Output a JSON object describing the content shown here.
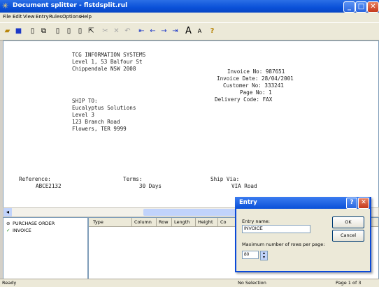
{
  "window": {
    "title": "Document splitter - flstdsplit.rul"
  },
  "menu": [
    "File",
    "Edit",
    "View",
    "Entry",
    "Rules",
    "Options",
    "Help"
  ],
  "toolbar": {
    "icons": [
      "open-icon",
      "save-icon",
      "new-doc-icon",
      "copy-doc-icon",
      "page-icon",
      "page2-icon",
      "page3-icon",
      "pointer-icon",
      "cut-icon",
      "delete-icon",
      "undo-icon",
      "first-icon",
      "prev-icon",
      "next-icon",
      "last-icon",
      "font-larger-icon",
      "font-smaller-icon",
      "help-icon"
    ]
  },
  "document": {
    "company": [
      "TCG INFORMATION SYSTEMS",
      "Level 1, 53 Balfour St",
      "Chippendale NSW 2008"
    ],
    "invoice_info": [
      "Invoice No: 987651",
      "Invoice Date: 28/04/2001",
      "Customer No: 333241",
      "Page No: 1",
      "Delivery Code: FAX"
    ],
    "ship_to": [
      "SHIP TO:",
      "Eucalyptus Solutions",
      "Level 3",
      "123 Branch Road",
      "Flowers, TER 9999"
    ],
    "reference_label": "Reference:",
    "reference_value": "ABCE2132",
    "terms_label": "Terms:",
    "terms_value": "30 Days",
    "ship_via_label": "Ship Via:",
    "ship_via_value": "VIA Road"
  },
  "tree": [
    "PURCHASE ORDER",
    "INVOICE"
  ],
  "grid": {
    "columns": [
      "Type",
      "Column",
      "Row",
      "Length",
      "Height",
      "Co"
    ]
  },
  "status": {
    "left": "Ready",
    "middle": "No Selection",
    "right": "Page 1 of 3"
  },
  "dialog": {
    "title": "Entry",
    "entry_name_label": "Entry name:",
    "entry_name_value": "INVOICE",
    "max_rows_label": "Maximum number of rows per page:",
    "max_rows_value": "80",
    "ok_label": "OK",
    "cancel_label": "Cancel"
  }
}
